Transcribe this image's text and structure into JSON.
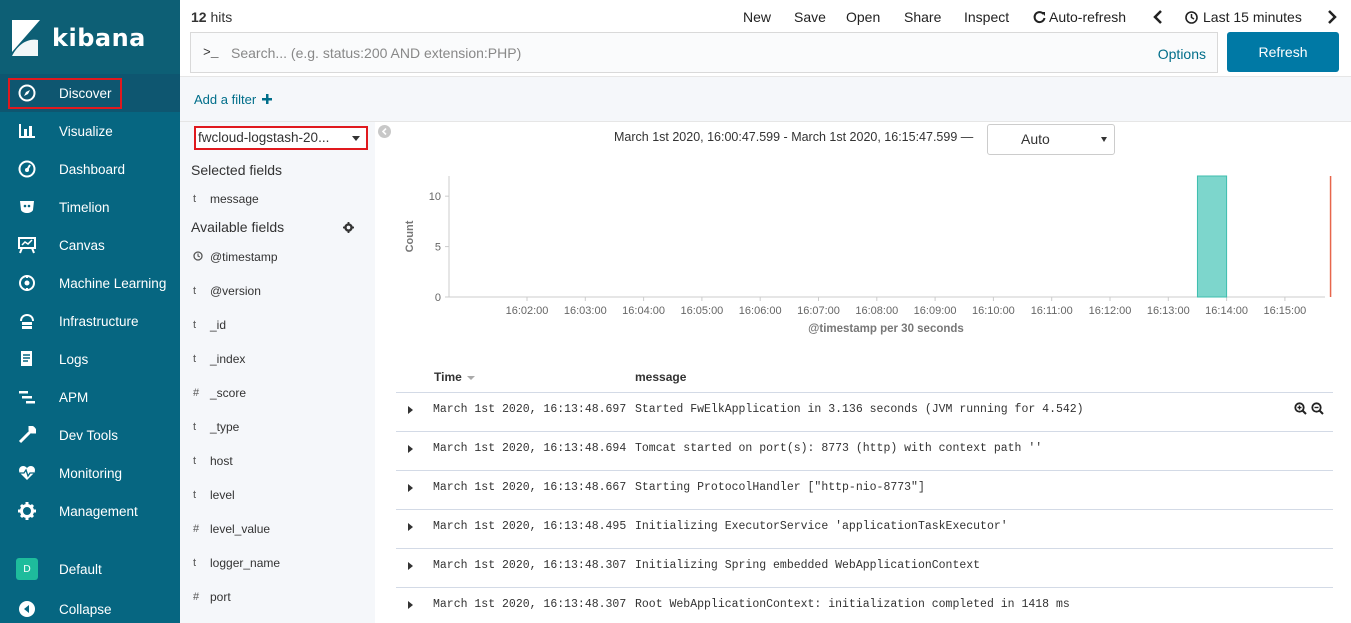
{
  "app": {
    "logo_text": "kibana"
  },
  "sidebar": {
    "items": [
      {
        "label": "Discover",
        "icon": "compass-icon"
      },
      {
        "label": "Visualize",
        "icon": "bar-chart-icon"
      },
      {
        "label": "Dashboard",
        "icon": "dashboard-icon"
      },
      {
        "label": "Timelion",
        "icon": "timelion-icon"
      },
      {
        "label": "Canvas",
        "icon": "canvas-icon"
      },
      {
        "label": "Machine Learning",
        "icon": "machine-learning-icon"
      },
      {
        "label": "Infrastructure",
        "icon": "infrastructure-icon"
      },
      {
        "label": "Logs",
        "icon": "logs-icon"
      },
      {
        "label": "APM",
        "icon": "apm-icon"
      },
      {
        "label": "Dev Tools",
        "icon": "wrench-icon"
      },
      {
        "label": "Monitoring",
        "icon": "heartbeat-icon"
      },
      {
        "label": "Management",
        "icon": "gear-icon"
      }
    ],
    "space": {
      "badge": "D",
      "label": "Default"
    },
    "collapse_label": "Collapse"
  },
  "topbar": {
    "hits_count": "12",
    "hits_label": "hits",
    "menu": [
      "New",
      "Save",
      "Open",
      "Share",
      "Inspect"
    ],
    "auto_refresh": "Auto-refresh",
    "time_label": "Last 15 minutes"
  },
  "search": {
    "prompt": ">_",
    "placeholder": "Search... (e.g. status:200 AND extension:PHP)",
    "options_label": "Options",
    "refresh_label": "Refresh"
  },
  "filters": {
    "add_label": "Add a filter"
  },
  "fields": {
    "index_pattern": "fwcloud-logstash-20...",
    "selected_title": "Selected fields",
    "selected": [
      {
        "type": "t",
        "name": "message"
      }
    ],
    "available_title": "Available fields",
    "available": [
      {
        "type": "clock",
        "name": "@timestamp"
      },
      {
        "type": "t",
        "name": "@version"
      },
      {
        "type": "t",
        "name": "_id"
      },
      {
        "type": "t",
        "name": "_index"
      },
      {
        "type": "#",
        "name": "_score"
      },
      {
        "type": "t",
        "name": "_type"
      },
      {
        "type": "t",
        "name": "host"
      },
      {
        "type": "t",
        "name": "level"
      },
      {
        "type": "#",
        "name": "level_value"
      },
      {
        "type": "t",
        "name": "logger_name"
      },
      {
        "type": "#",
        "name": "port"
      }
    ]
  },
  "histogram": {
    "time_range": "March 1st 2020, 16:00:47.599 - March 1st 2020, 16:15:47.599 —",
    "interval": "Auto"
  },
  "chart_data": {
    "type": "bar",
    "xlabel": "@timestamp per 30 seconds",
    "ylabel": "Count",
    "x_ticks": [
      "16:02:00",
      "16:03:00",
      "16:04:00",
      "16:05:00",
      "16:06:00",
      "16:07:00",
      "16:08:00",
      "16:09:00",
      "16:10:00",
      "16:11:00",
      "16:12:00",
      "16:13:00",
      "16:14:00",
      "16:15:00"
    ],
    "y_ticks": [
      0,
      5,
      10
    ],
    "ylim": [
      0,
      12
    ],
    "bars": [
      {
        "x_start": "16:13:30",
        "x_end": "16:14:00",
        "value": 12
      }
    ],
    "now_marker": "16:15:47",
    "colors": {
      "bar": "#7dd6cc",
      "bar_stroke": "#3ebeae",
      "now_line": "#e7664c"
    }
  },
  "table": {
    "columns": [
      "Time",
      "message"
    ],
    "rows": [
      {
        "time": "March 1st 2020, 16:13:48.697",
        "message": "Started FwElkApplication in 3.136 seconds (JVM running for 4.542)"
      },
      {
        "time": "March 1st 2020, 16:13:48.694",
        "message": "Tomcat started on port(s): 8773 (http) with context path ''"
      },
      {
        "time": "March 1st 2020, 16:13:48.667",
        "message": "Starting ProtocolHandler [\"http-nio-8773\"]"
      },
      {
        "time": "March 1st 2020, 16:13:48.495",
        "message": "Initializing ExecutorService 'applicationTaskExecutor'"
      },
      {
        "time": "March 1st 2020, 16:13:48.307",
        "message": "Initializing Spring embedded WebApplicationContext"
      },
      {
        "time": "March 1st 2020, 16:13:48.307",
        "message": "Root WebApplicationContext: initialization completed in 1418 ms"
      }
    ]
  }
}
